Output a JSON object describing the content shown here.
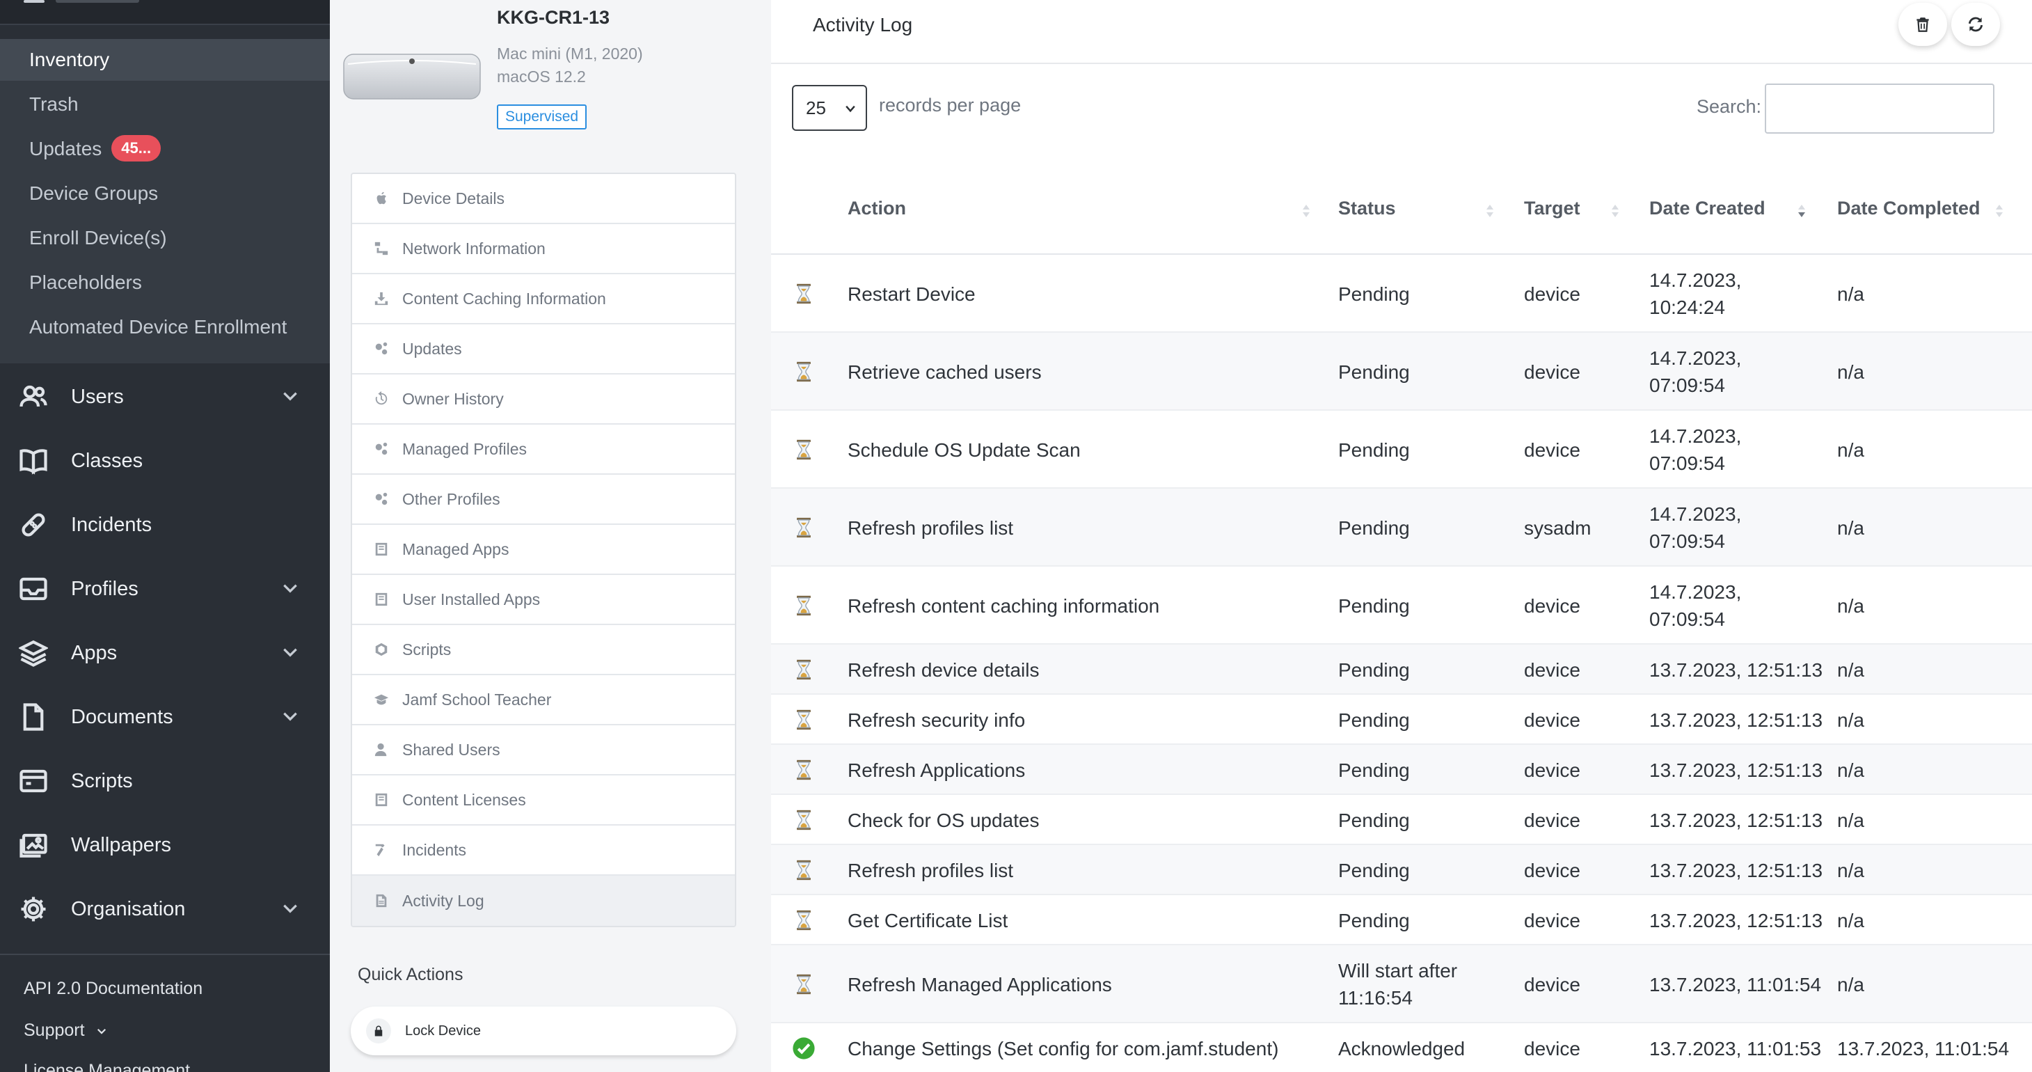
{
  "sidebar": {
    "sub_items": [
      {
        "label": "Inventory",
        "active": true
      },
      {
        "label": "Trash"
      },
      {
        "label": "Updates",
        "badge": "45..."
      },
      {
        "label": "Device Groups"
      },
      {
        "label": "Enroll Device(s)"
      },
      {
        "label": "Placeholders"
      },
      {
        "label": "Automated Device Enrollment"
      }
    ],
    "items": [
      {
        "label": "Users",
        "icon": "users-icon",
        "expandable": true
      },
      {
        "label": "Classes",
        "icon": "book-icon",
        "expandable": false
      },
      {
        "label": "Incidents",
        "icon": "bandage-icon",
        "expandable": false
      },
      {
        "label": "Profiles",
        "icon": "inbox-icon",
        "expandable": true
      },
      {
        "label": "Apps",
        "icon": "layers-icon",
        "expandable": true
      },
      {
        "label": "Documents",
        "icon": "document-icon",
        "expandable": true
      },
      {
        "label": "Scripts",
        "icon": "terminal-icon",
        "expandable": false
      },
      {
        "label": "Wallpapers",
        "icon": "image-icon",
        "expandable": false
      },
      {
        "label": "Organisation",
        "icon": "gear-icon",
        "expandable": true
      }
    ],
    "footer": {
      "api_docs": "API 2.0 Documentation",
      "support": "Support",
      "license": "License Management"
    }
  },
  "device": {
    "name": "KKG-CR1-13",
    "model": "Mac mini (M1, 2020)",
    "os": "macOS 12.2",
    "status": "Supervised"
  },
  "device_menu": [
    {
      "label": "Device Details",
      "icon": "apple-icon"
    },
    {
      "label": "Network Information",
      "icon": "network-icon"
    },
    {
      "label": "Content Caching Information",
      "icon": "download-icon"
    },
    {
      "label": "Updates",
      "icon": "cogs-icon"
    },
    {
      "label": "Owner History",
      "icon": "history-icon"
    },
    {
      "label": "Managed Profiles",
      "icon": "cogs-icon"
    },
    {
      "label": "Other Profiles",
      "icon": "cogs-icon"
    },
    {
      "label": "Managed Apps",
      "icon": "app-icon"
    },
    {
      "label": "User Installed Apps",
      "icon": "app-icon"
    },
    {
      "label": "Scripts",
      "icon": "script-icon"
    },
    {
      "label": "Jamf School Teacher",
      "icon": "graduation-cap-icon"
    },
    {
      "label": "Shared Users",
      "icon": "user-icon"
    },
    {
      "label": "Content Licenses",
      "icon": "app-icon"
    },
    {
      "label": "Incidents",
      "icon": "hammer-icon"
    },
    {
      "label": "Activity Log",
      "icon": "file-icon",
      "active": true
    }
  ],
  "quick_actions": {
    "title": "Quick Actions",
    "lock_device": "Lock Device"
  },
  "activity_log": {
    "title": "Activity Log",
    "records_per_page": "25",
    "records_label": "records per page",
    "search_label": "Search:",
    "search_value": "",
    "columns": [
      "Action",
      "Status",
      "Target",
      "Date Created",
      "Date Completed"
    ],
    "rows": [
      {
        "icon": "hourglass-icon",
        "action": "Restart Device",
        "status": "Pending",
        "target": "device",
        "created": [
          "14.7.2023,",
          "10:24:24"
        ],
        "completed": "n/a"
      },
      {
        "icon": "hourglass-icon",
        "action": "Retrieve cached users",
        "status": "Pending",
        "target": "device",
        "created": [
          "14.7.2023,",
          "07:09:54"
        ],
        "completed": "n/a"
      },
      {
        "icon": "hourglass-icon",
        "action": "Schedule OS Update Scan",
        "status": "Pending",
        "target": "device",
        "created": [
          "14.7.2023,",
          "07:09:54"
        ],
        "completed": "n/a"
      },
      {
        "icon": "hourglass-icon",
        "action": "Refresh profiles list",
        "status": "Pending",
        "target": "sysadm",
        "created": [
          "14.7.2023,",
          "07:09:54"
        ],
        "completed": "n/a"
      },
      {
        "icon": "hourglass-icon",
        "action": "Refresh content caching information",
        "status": "Pending",
        "target": "device",
        "created": [
          "14.7.2023,",
          "07:09:54"
        ],
        "completed": "n/a"
      },
      {
        "icon": "hourglass-icon",
        "action": "Refresh device details",
        "status": "Pending",
        "target": "device",
        "created": [
          "13.7.2023, 12:51:13"
        ],
        "completed": "n/a"
      },
      {
        "icon": "hourglass-icon",
        "action": "Refresh security info",
        "status": "Pending",
        "target": "device",
        "created": [
          "13.7.2023, 12:51:13"
        ],
        "completed": "n/a"
      },
      {
        "icon": "hourglass-icon",
        "action": "Refresh Applications",
        "status": "Pending",
        "target": "device",
        "created": [
          "13.7.2023, 12:51:13"
        ],
        "completed": "n/a"
      },
      {
        "icon": "hourglass-icon",
        "action": "Check for OS updates",
        "status": "Pending",
        "target": "device",
        "created": [
          "13.7.2023, 12:51:13"
        ],
        "completed": "n/a"
      },
      {
        "icon": "hourglass-icon",
        "action": "Refresh profiles list",
        "status": "Pending",
        "target": "device",
        "created": [
          "13.7.2023, 12:51:13"
        ],
        "completed": "n/a"
      },
      {
        "icon": "hourglass-icon",
        "action": "Get Certificate List",
        "status": "Pending",
        "target": "device",
        "created": [
          "13.7.2023, 12:51:13"
        ],
        "completed": "n/a"
      },
      {
        "icon": "hourglass-icon",
        "action": "Refresh Managed Applications",
        "status": "Will start after 11:16:54",
        "target": "device",
        "created": [
          "13.7.2023, 11:01:54"
        ],
        "completed": "n/a"
      },
      {
        "icon": "check-circle-icon",
        "action": "Change Settings (Set config for com.jamf.student)",
        "status": "Acknowledged",
        "target": "device",
        "created": [
          "13.7.2023, 11:01:53"
        ],
        "completed": "13.7.2023, 11:01:54"
      }
    ]
  },
  "colors": {
    "sidebar_bg": "#2a2f36",
    "badge": "#e8505b",
    "supervised": "#2a8ee0",
    "hourglass": "#d9a441",
    "check": "#3aaa35"
  }
}
